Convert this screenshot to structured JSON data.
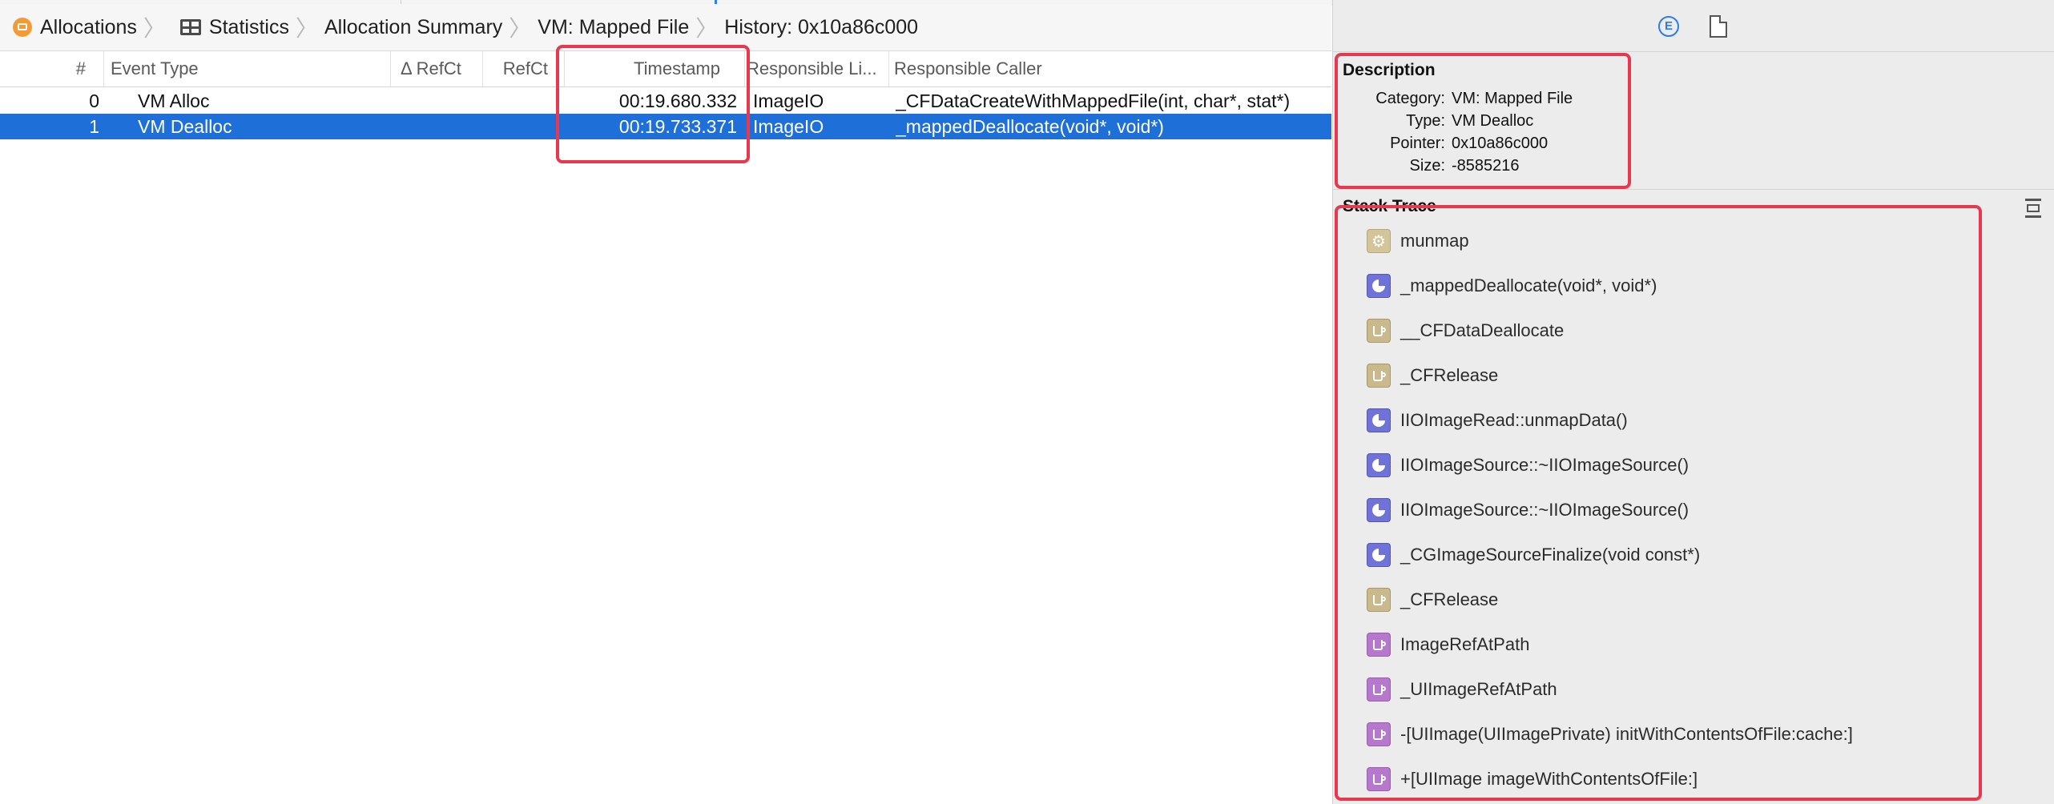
{
  "breadcrumb": {
    "items": [
      "Allocations",
      "Statistics",
      "Allocation Summary",
      "VM: Mapped File",
      "History: 0x10a86c000"
    ]
  },
  "table": {
    "columns": [
      "#",
      "Event Type",
      "Δ RefCt",
      "RefCt",
      "Timestamp",
      "Responsible Li...",
      "Responsible Caller"
    ],
    "rows": [
      {
        "num": "0",
        "event": "VM Alloc",
        "delta": "",
        "refct": "",
        "timestamp": "00:19.680.332",
        "lib": "ImageIO",
        "caller": "_CFDataCreateWithMappedFile(int, char*, stat*)",
        "selected": false
      },
      {
        "num": "1",
        "event": "VM Dealloc",
        "delta": "",
        "refct": "",
        "timestamp": "00:19.733.371",
        "lib": "ImageIO",
        "caller": "_mappedDeallocate(void*, void*)",
        "selected": true
      }
    ]
  },
  "inspector": {
    "top_icons": {
      "extended": "E"
    },
    "description": {
      "title": "Description",
      "fields": [
        {
          "key": "Category:",
          "value": "VM: Mapped File"
        },
        {
          "key": "Type:",
          "value": "VM Dealloc"
        },
        {
          "key": "Pointer:",
          "value": "0x10a86c000"
        },
        {
          "key": "Size:",
          "value": "-8585216"
        }
      ]
    },
    "stack_trace": {
      "title": "Stack Trace",
      "frames": [
        {
          "icon": "gear",
          "label": "munmap"
        },
        {
          "icon": "pie",
          "label": "_mappedDeallocate(void*, void*)"
        },
        {
          "icon": "cup",
          "label": "__CFDataDeallocate"
        },
        {
          "icon": "cup",
          "label": "_CFRelease"
        },
        {
          "icon": "pie",
          "label": "IIOImageRead::unmapData()"
        },
        {
          "icon": "pie",
          "label": "IIOImageSource::~IIOImageSource()"
        },
        {
          "icon": "pie",
          "label": "IIOImageSource::~IIOImageSource()"
        },
        {
          "icon": "pie",
          "label": "_CGImageSourceFinalize(void const*)"
        },
        {
          "icon": "cup",
          "label": "_CFRelease"
        },
        {
          "icon": "cuppurple",
          "label": "ImageRefAtPath"
        },
        {
          "icon": "cuppurple",
          "label": "_UIImageRefAtPath"
        },
        {
          "icon": "cuppurple",
          "label": "-[UIImage(UIImagePrivate) initWithContentsOfFile:cache:]"
        },
        {
          "icon": "cuppurple",
          "label": "+[UIImage imageWithContentsOfFile:]"
        }
      ]
    }
  },
  "colors": {
    "selection": "#1f6fd8",
    "annotation": "#e8384f",
    "accent_blue": "#2b7de9"
  }
}
